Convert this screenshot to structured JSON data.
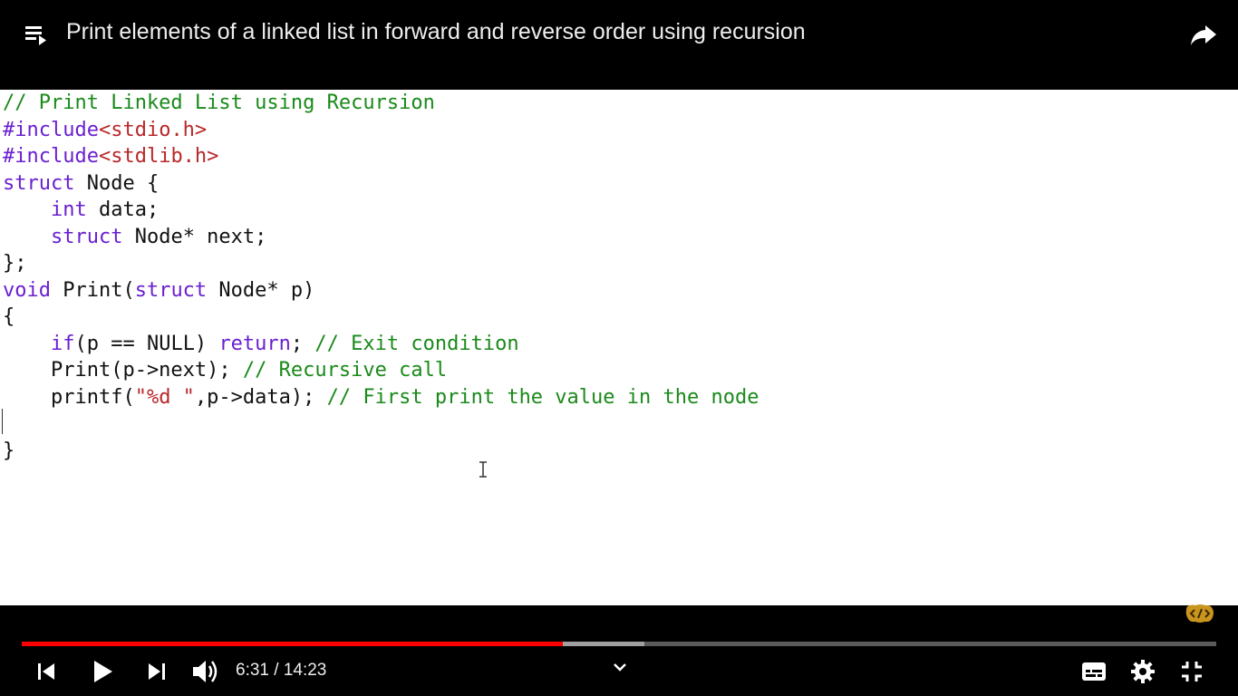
{
  "header": {
    "title": "Print elements of a linked list in forward and reverse order using recursion"
  },
  "code": {
    "lines": [
      [
        {
          "t": "// Print Linked List using Recursion",
          "c": "cm"
        }
      ],
      [
        {
          "t": "#include",
          "c": "kw"
        },
        {
          "t": "<stdio.h>",
          "c": "st"
        }
      ],
      [
        {
          "t": "#include",
          "c": "kw"
        },
        {
          "t": "<stdlib.h>",
          "c": "st"
        }
      ],
      [
        {
          "t": "struct",
          "c": "kw"
        },
        {
          "t": " Node {",
          "c": ""
        }
      ],
      [
        {
          "t": "    ",
          "c": ""
        },
        {
          "t": "int",
          "c": "kw"
        },
        {
          "t": " data;",
          "c": ""
        }
      ],
      [
        {
          "t": "    ",
          "c": ""
        },
        {
          "t": "struct",
          "c": "kw"
        },
        {
          "t": " Node* next;",
          "c": ""
        }
      ],
      [
        {
          "t": "};",
          "c": ""
        }
      ],
      [
        {
          "t": "void",
          "c": "kw"
        },
        {
          "t": " Print(",
          "c": ""
        },
        {
          "t": "struct",
          "c": "kw"
        },
        {
          "t": " Node* p)",
          "c": ""
        }
      ],
      [
        {
          "t": "{",
          "c": ""
        }
      ],
      [
        {
          "t": "    ",
          "c": ""
        },
        {
          "t": "if",
          "c": "kw"
        },
        {
          "t": "(p == NULL) ",
          "c": ""
        },
        {
          "t": "return",
          "c": "kw"
        },
        {
          "t": "; ",
          "c": ""
        },
        {
          "t": "// Exit condition",
          "c": "cm"
        }
      ],
      [
        {
          "t": "    Print(p->next); ",
          "c": ""
        },
        {
          "t": "// Recursive call",
          "c": "cm"
        }
      ],
      [
        {
          "t": "    printf(",
          "c": ""
        },
        {
          "t": "\"%d \"",
          "c": "st"
        },
        {
          "t": ",p->data); ",
          "c": ""
        },
        {
          "t": "// First print the value in the node",
          "c": "cm"
        }
      ],
      [
        {
          "t": "",
          "c": ""
        }
      ],
      [
        {
          "t": "}",
          "c": ""
        }
      ]
    ]
  },
  "player": {
    "current_time": "6:31",
    "duration": "14:23",
    "time_text": "6:31 / 14:23",
    "played_fraction": 0.4532,
    "buffered_fraction": 0.5212
  },
  "icons": {
    "playlist": "playlist-icon",
    "share": "share-icon",
    "previous": "previous-icon",
    "play": "play-icon",
    "next": "next-icon",
    "volume": "volume-icon",
    "chevron": "chevron-down-icon",
    "subtitles": "subtitles-icon",
    "settings": "gear-icon",
    "exit_fullscreen": "exit-fullscreen-icon",
    "watermark": "mycodeschool-logo"
  },
  "colors": {
    "progress_played": "#ff0000",
    "progress_buffered": "#a0a0a0",
    "progress_track": "#5a5a5a",
    "keyword": "#6a1fd0",
    "comment": "#1a8a1a",
    "string": "#b8282a"
  }
}
